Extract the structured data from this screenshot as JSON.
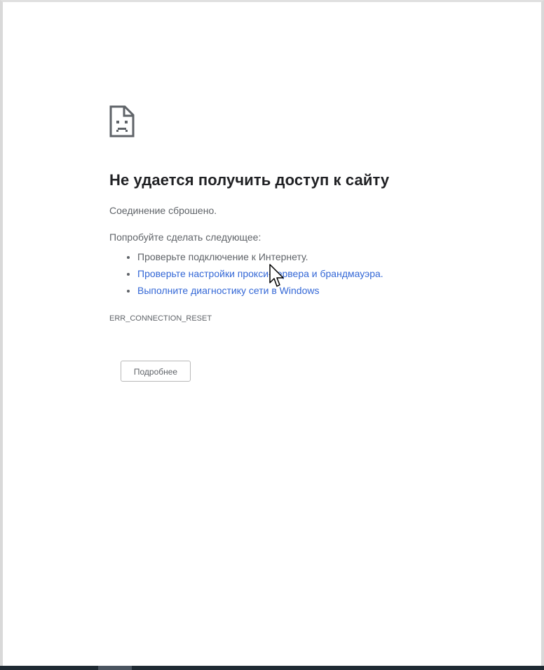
{
  "error_page": {
    "title": "Не удается получить доступ к сайту",
    "subtitle": "Соединение сброшено.",
    "suggest_heading": "Попробуйте сделать следующее:",
    "suggestions": [
      "Проверьте подключение к Интернету.",
      "Проверьте настройки прокси-сервера и брандмауэра.",
      "Выполните диагностику сети в Windows"
    ],
    "error_code": "ERR_CONNECTION_RESET",
    "details_button": "Подробнее"
  },
  "colors": {
    "heading": "#202124",
    "text": "#5f6368",
    "link": "#3367d6"
  },
  "icons": {
    "error": "sad-page-icon",
    "cursor": "mouse-pointer-icon"
  }
}
